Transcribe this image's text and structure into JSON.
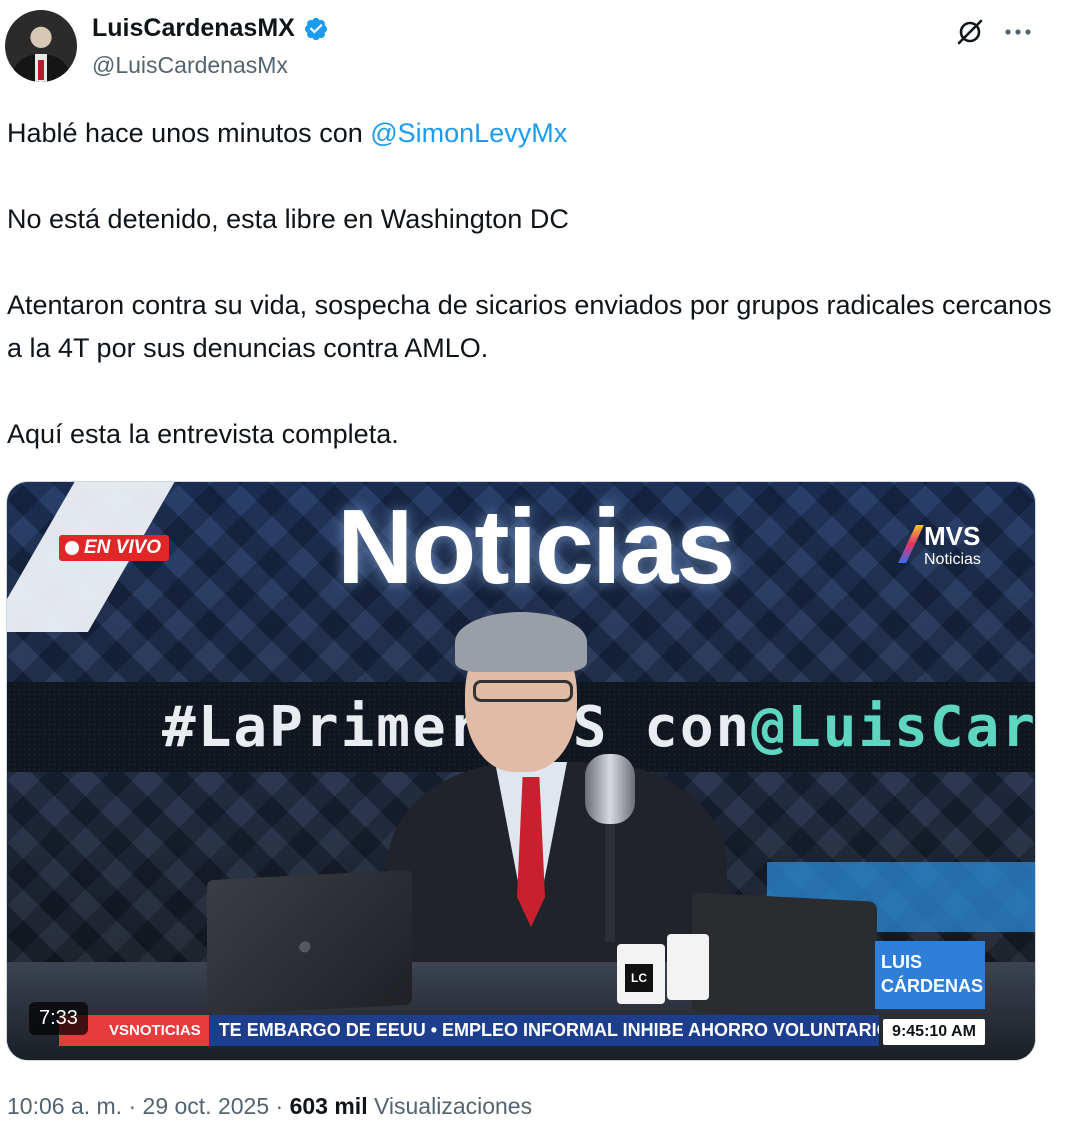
{
  "author": {
    "display_name": "LuisCardenasMX",
    "handle": "@LuisCardenasMx",
    "verified_icon": "verified-badge-icon",
    "avatar_icon": "avatar"
  },
  "actions": {
    "grok_icon": "grok-icon",
    "more_icon": "more-icon"
  },
  "tweet": {
    "line1_prefix": "Hablé hace unos minutos con ",
    "line1_mention": "@SimonLevyMx",
    "line2": "No está detenido, esta libre en Washington DC",
    "line3": "Atentaron contra su vida, sospecha de sicarios enviados por grupos radicales cercanos a la 4T por sus denuncias contra AMLO.",
    "line4": "Aquí esta la entrevista completa."
  },
  "video": {
    "sign_text": "Noticias",
    "live_badge": "EN VIVO",
    "mvs_logo": "MVS",
    "mvs_logo_sub": "Noticias",
    "led_text_1": "#LaPrimer",
    "led_text_2": "MVS con ",
    "led_text_3": "@LuisCar",
    "mug_logo": "LC",
    "name_tag": "LUIS CÁRDENAS",
    "ticker_tag": "VSNOTICIAS",
    "ticker_text": "TE EMBARGO DE EEUU • EMPLEO INFORMAL INHIBE AHORRO VOLUNTARIO EN",
    "clock": "9:45:10 AM",
    "duration": "7:33"
  },
  "meta": {
    "time": "10:06 a. m.",
    "separator": " · ",
    "date": "29 oct. 2025",
    "views_count": "603 mil",
    "views_label": " Visualizaciones"
  },
  "colors": {
    "text_primary": "#0f1419",
    "text_secondary": "#536471",
    "link": "#1d9bf0",
    "verified": "#1d9bf0",
    "live_red": "#e02727"
  }
}
